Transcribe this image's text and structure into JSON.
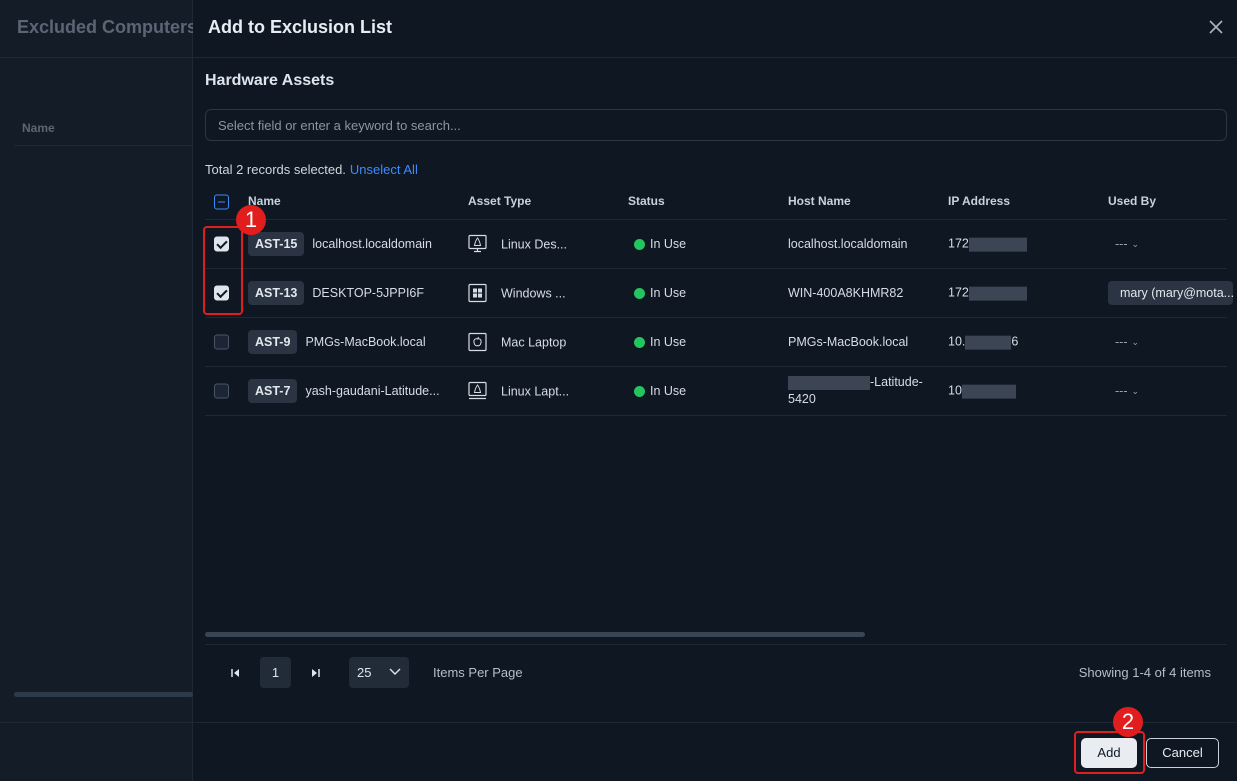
{
  "background": {
    "title": "Excluded Computers",
    "column_name": "Name"
  },
  "modal": {
    "title": "Add to Exclusion List",
    "section_title": "Hardware Assets",
    "search_placeholder": "Select field or enter a keyword to search...",
    "selection_text": "Total 2 records selected.",
    "unselect_all": "Unselect All",
    "columns": [
      "Name",
      "Asset Type",
      "Status",
      "Host Name",
      "IP Address",
      "Used By"
    ],
    "rows": [
      {
        "checked": true,
        "id": "AST-15",
        "name": "localhost.localdomain",
        "type": "Linux Des...",
        "type_icon": "linux-desktop-icon",
        "status": "In Use",
        "host": "localhost.localdomain",
        "ip": "172",
        "used_by": "---"
      },
      {
        "checked": true,
        "id": "AST-13",
        "name": "DESKTOP-5JPPI6F",
        "type": "Windows ...",
        "type_icon": "windows-icon",
        "status": "In Use",
        "host": "WIN-400A8KHMR82",
        "ip": "172",
        "used_by": "mary (mary@mota..."
      },
      {
        "checked": false,
        "id": "AST-9",
        "name": "PMGs-MacBook.local",
        "type": "Mac Laptop",
        "type_icon": "mac-laptop-icon",
        "status": "In Use",
        "host": "PMGs-MacBook.local",
        "ip_prefix": "10.",
        "ip_suffix": "6",
        "used_by": "---"
      },
      {
        "checked": false,
        "id": "AST-7",
        "name": "yash-gaudani-Latitude...",
        "type": "Linux Lapt...",
        "type_icon": "linux-laptop-icon",
        "status": "In Use",
        "host_suffix": "-Latitude-",
        "host_line2": "5420",
        "ip": "10",
        "used_by": "---"
      }
    ],
    "pagination": {
      "current_page": "1",
      "page_size": "25",
      "items_per_page_label": "Items Per Page",
      "showing": "Showing 1-4 of 4 items"
    },
    "buttons": {
      "add": "Add",
      "cancel": "Cancel"
    }
  },
  "annotations": {
    "step1": "1",
    "step2": "2"
  },
  "colors": {
    "status_green": "#22c55e",
    "link_blue": "#3d8bfd",
    "annotation_red": "#e11d1d"
  }
}
